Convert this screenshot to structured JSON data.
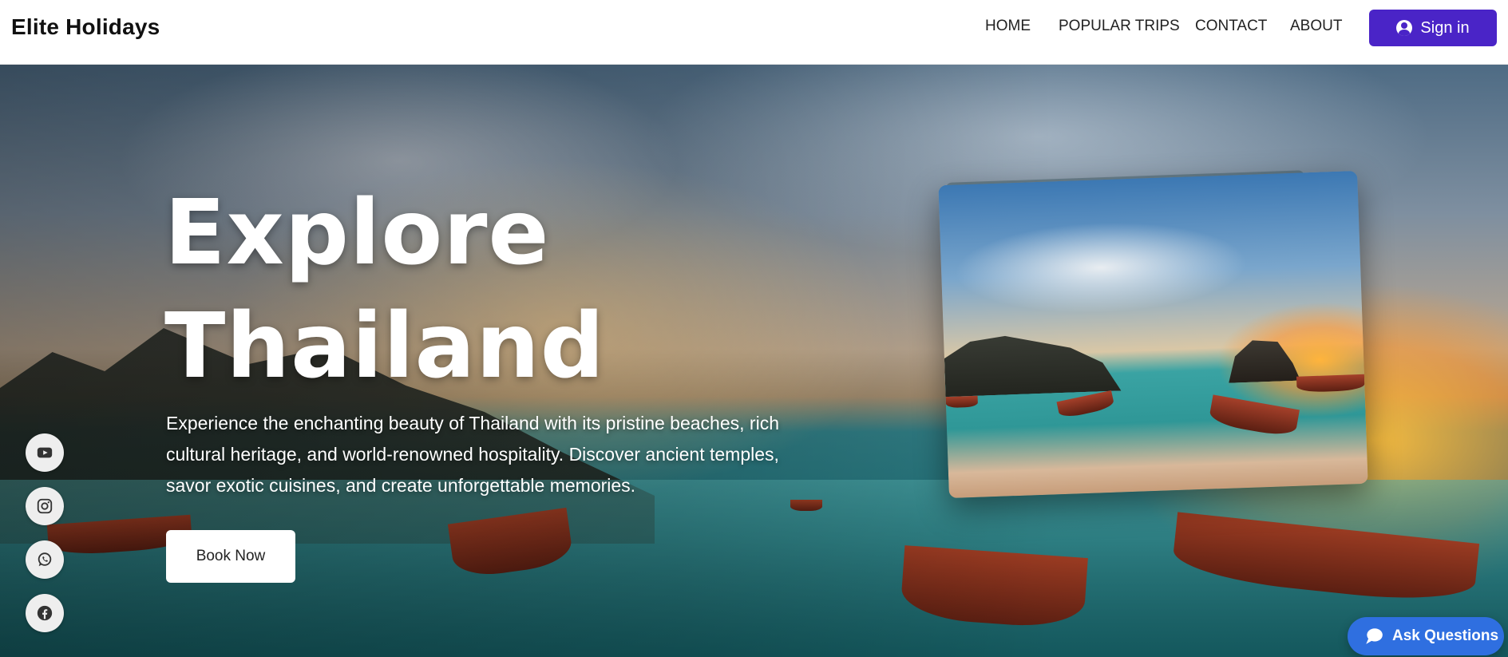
{
  "navbar": {
    "brand": "Elite Holidays",
    "links": [
      "HOME",
      "POPULAR TRIPS",
      "CONTACT",
      "ABOUT"
    ],
    "signin_label": "Sign in",
    "signin_color": "#4a24c7"
  },
  "hero": {
    "title_line1": "Explore",
    "title_line2": "Thailand",
    "description": "Experience the enchanting beauty of Thailand with its pristine beaches, rich cultural heritage, and world-renowned hospitality. Discover ancient temples, savor exotic cuisines, and create unforgettable memories.",
    "cta_label": "Book Now"
  },
  "social": {
    "items": [
      "youtube-icon",
      "instagram-icon",
      "whatsapp-icon",
      "facebook-icon"
    ]
  },
  "chat": {
    "label": "Ask Questions",
    "color": "#2f6fe0"
  }
}
